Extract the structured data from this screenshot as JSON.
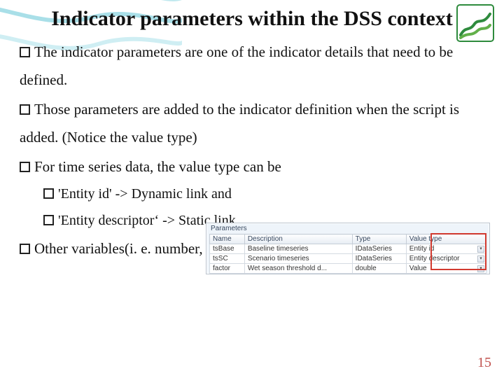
{
  "title": "Indicator parameters within the DSS context",
  "bullets": [
    "The indicator parameters are one of the indicator details that need to be defined.",
    "Those parameters are added to the indicator definition when the script is added. (Notice the value type)",
    "For time series data, the value type can be",
    "Other  variables(i. e. number, string or Boolean) take a value type ‘Value’"
  ],
  "sub": [
    "'Entity id' -> Dynamic link and",
    "'Entity descriptor‘ -> Static link"
  ],
  "panel": {
    "title": "Parameters",
    "headers": [
      "Name",
      "Description",
      "Type",
      "Value type"
    ],
    "rows": [
      {
        "name": "tsBase",
        "desc": "Baseline timeseries",
        "type": "IDataSeries",
        "vt": "Entity id"
      },
      {
        "name": "tsSC",
        "desc": "Scenario timeseries",
        "type": "IDataSeries",
        "vt": "Entity descriptor"
      },
      {
        "name": "factor",
        "desc": "Wet season threshold d...",
        "type": "double",
        "vt": "Value"
      }
    ]
  },
  "page_number": "15"
}
